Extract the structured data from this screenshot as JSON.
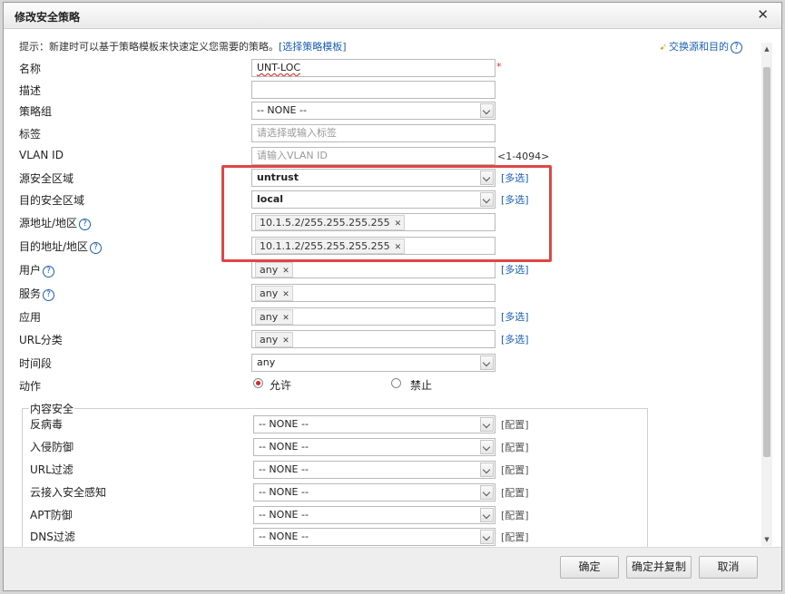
{
  "dialog": {
    "title": "修改安全策略",
    "close": "✕"
  },
  "hint": {
    "text": "提示：新建时可以基于策略模板来快速定义您需要的策略。",
    "link": "[选择策略模板]"
  },
  "swap": {
    "icon": "swap-arrows-icon",
    "label": "交换源和目的",
    "help": "?"
  },
  "help_glyph": "?",
  "fields": {
    "name": {
      "label": "名称",
      "value": "UNT-LOC",
      "required": "*"
    },
    "description": {
      "label": "描述",
      "value": ""
    },
    "policy_group": {
      "label": "策略组",
      "value": "-- NONE --"
    },
    "tag": {
      "label": "标签",
      "placeholder": "请选择或输入标签"
    },
    "vlan": {
      "label": "VLAN ID",
      "placeholder": "请输入VLAN ID",
      "range": "<1-4094>"
    },
    "src_zone": {
      "label": "源安全区域",
      "value": "untrust",
      "multi": "[多选]"
    },
    "dst_zone": {
      "label": "目的安全区域",
      "value": "local",
      "multi": "[多选]"
    },
    "src_addr": {
      "label": "源地址/地区",
      "tag": "10.1.5.2/255.255.255.255"
    },
    "dst_addr": {
      "label": "目的地址/地区",
      "tag": "10.1.1.2/255.255.255.255"
    },
    "user": {
      "label": "用户",
      "tag": "any",
      "multi": "[多选]"
    },
    "service": {
      "label": "服务",
      "tag": "any"
    },
    "application": {
      "label": "应用",
      "tag": "any",
      "multi": "[多选]"
    },
    "url_category": {
      "label": "URL分类",
      "tag": "any",
      "multi": "[多选]"
    },
    "time_range": {
      "label": "时间段",
      "value": "any"
    },
    "action": {
      "label": "动作",
      "allow": "允许",
      "deny": "禁止",
      "selected": "允许"
    }
  },
  "tag_remove": "✕",
  "content_security": {
    "legend": "内容安全",
    "config_label": "[配置]",
    "rows": [
      {
        "label": "反病毒",
        "value": "-- NONE --"
      },
      {
        "label": "入侵防御",
        "value": "-- NONE --"
      },
      {
        "label": "URL过滤",
        "value": "-- NONE --"
      },
      {
        "label": "云接入安全感知",
        "value": "-- NONE --"
      },
      {
        "label": "APT防御",
        "value": "-- NONE --"
      },
      {
        "label": "DNS过滤",
        "value": "-- NONE --"
      }
    ]
  },
  "scrollbar": {
    "up": "▲",
    "down": "▼"
  },
  "buttons": {
    "ok": "确定",
    "ok_copy": "确定并复制",
    "cancel": "取消"
  },
  "colors": {
    "link": "#1a5fb4",
    "highlight": "#e04545",
    "radio_selected": "#d22222"
  }
}
